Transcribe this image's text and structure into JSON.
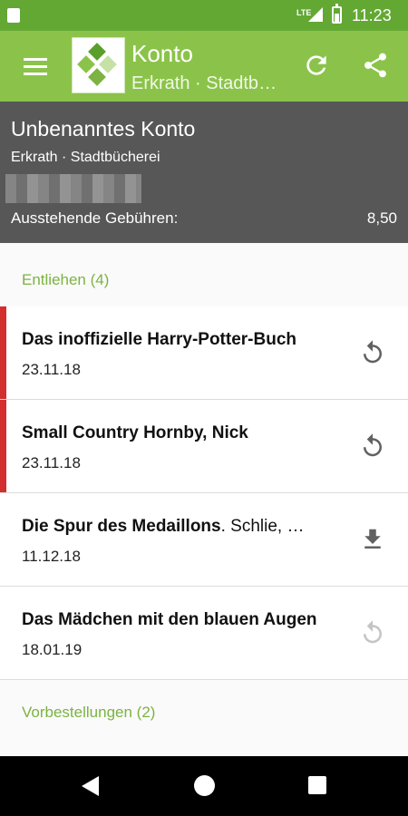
{
  "status_bar": {
    "network": "LTE",
    "time": "11:23"
  },
  "app_bar": {
    "title": "Konto",
    "subtitle": "Erkrath · Stadtbücherei",
    "icons": [
      "menu-icon",
      "logo",
      "refresh-icon",
      "share-icon"
    ]
  },
  "account": {
    "name": "Unbenanntes Konto",
    "library": "Erkrath · Stadtbücherei",
    "fees_label": "Ausstehende Gebühren:",
    "fees_value": "8,50"
  },
  "lent": {
    "header": "Entliehen (4)",
    "items": [
      {
        "title": "Das inoffizielle Harry-Potter-Buch",
        "author": "",
        "date": "23.11.18",
        "overdue": true,
        "action": "renew-icon",
        "action_enabled": true
      },
      {
        "title": "Small Country Hornby, Nick",
        "author": "",
        "date": "23.11.18",
        "overdue": true,
        "action": "renew-icon",
        "action_enabled": true
      },
      {
        "title": "Die Spur des Medaillons",
        "author": ". Schlie, …",
        "date": "11.12.18",
        "overdue": false,
        "action": "download-icon",
        "action_enabled": true
      },
      {
        "title": "Das Mädchen mit den blauen Augen",
        "author": "",
        "date": "18.01.19",
        "overdue": false,
        "action": "renew-icon",
        "action_enabled": false
      }
    ]
  },
  "reservations": {
    "header": "Vorbestellungen (2)"
  },
  "colors": {
    "accent": "#8bc34a",
    "status_bar": "#63a833",
    "overdue": "#d32f2f",
    "header_bg": "#575757"
  }
}
